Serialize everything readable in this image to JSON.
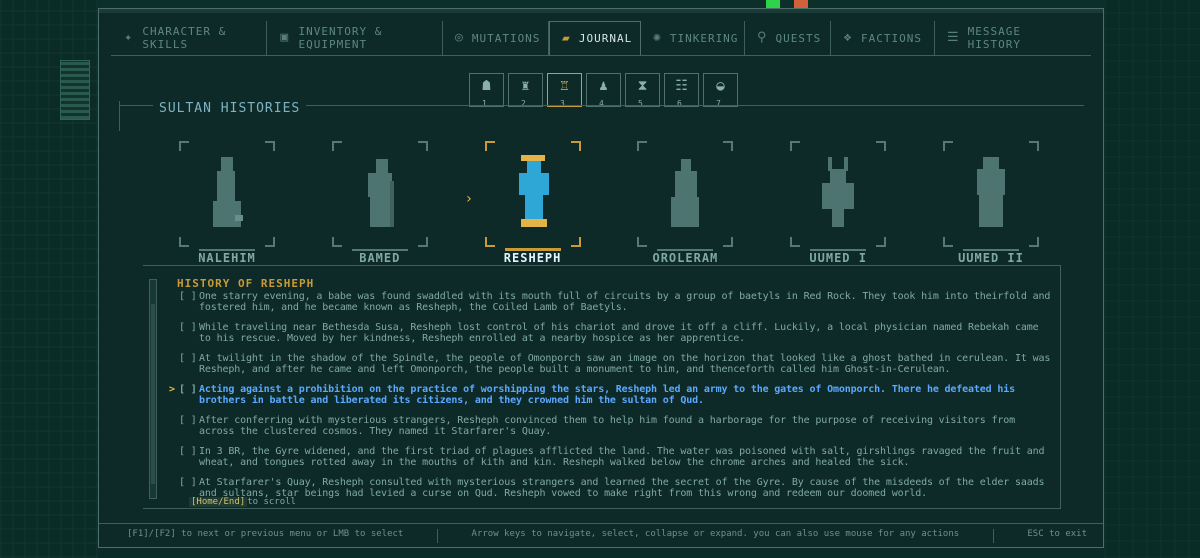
{
  "tabs": [
    {
      "label": "CHARACTER & SKILLS",
      "icon": "character-icon"
    },
    {
      "label": "INVENTORY & EQUIPMENT",
      "icon": "chest-icon"
    },
    {
      "label": "MUTATIONS",
      "icon": "mutation-icon"
    },
    {
      "label": "JOURNAL",
      "icon": "journal-icon",
      "active": true
    },
    {
      "label": "TINKERING",
      "icon": "gear-icon"
    },
    {
      "label": "QUESTS",
      "icon": "quest-icon"
    },
    {
      "label": "FACTIONS",
      "icon": "factions-icon"
    },
    {
      "label": "MESSAGE HISTORY",
      "icon": "message-icon"
    }
  ],
  "subtabs": [
    {
      "num": "1",
      "icon": "person-icon"
    },
    {
      "num": "2",
      "icon": "map-icon"
    },
    {
      "num": "3",
      "icon": "sultan-icon",
      "active": true
    },
    {
      "num": "4",
      "icon": "bell-icon"
    },
    {
      "num": "5",
      "icon": "hourglass-icon"
    },
    {
      "num": "6",
      "icon": "list-icon"
    },
    {
      "num": "7",
      "icon": "bowl-icon"
    }
  ],
  "section_title": "SULTAN HISTORIES",
  "sultans": [
    {
      "name": "NALEHIM"
    },
    {
      "name": "BAMED"
    },
    {
      "name": "RESHEPH",
      "active": true
    },
    {
      "name": "OROLERAM"
    },
    {
      "name": "UUMED I"
    },
    {
      "name": "UUMED II"
    }
  ],
  "history_title": "HISTORY OF RESHEPH",
  "entries": [
    {
      "box": "[ ]",
      "text": "One starry evening, a babe was found swaddled with its mouth full of circuits by a group of baetyls in Red Rock. They took him into theirfold and fostered him, and he became known as Resheph, the Coiled Lamb of Baetyls."
    },
    {
      "box": "[ ]",
      "text": "While traveling near Bethesda Susa, Resheph lost control of his chariot and drove it off a cliff. Luckily, a local physician named Rebekah came to his rescue. Moved by her kindness, Resheph enrolled at a nearby hospice as her apprentice."
    },
    {
      "box": "[ ]",
      "text": "At twilight in the shadow of the Spindle, the people of Omonporch saw an image on the horizon that looked like a ghost bathed in cerulean. It was Resheph, and after he came and left Omonporch, the people built a monument to him, and thenceforth called him Ghost-in-Cerulean."
    },
    {
      "box": "[ ]",
      "caret": ">",
      "active": true,
      "text": "Acting against a prohibition on the practice of worshipping the stars, Resheph led an army to the gates of Omonporch. There he defeated his brothers in battle and liberated its citizens, and they crowned him the sultan of Qud."
    },
    {
      "box": "[ ]",
      "text": "After conferring with mysterious strangers, Resheph convinced them to help him found a harborage for the purpose of receiving visitors from across the clustered cosmos. They named it Starfarer's Quay."
    },
    {
      "box": "[ ]",
      "text": "In 3 BR, the Gyre widened, and the first triad of plagues afflicted the land. The water was poisoned with salt, girshlings ravaged the fruit and wheat, and tongues rotted away in the mouths of kith and kin. Resheph walked below the chrome arches and healed the sick."
    },
    {
      "box": "[ ]",
      "text": "At Starfarer's Quay, Resheph consulted with mysterious strangers and learned the secret of the Gyre. By cause of the misdeeds of the elder  saads and sultans, star beings had levied a curse on Qud. Resheph vowed to make right from this wrong and redeem our doomed world."
    }
  ],
  "scroll_hint": {
    "key": "[Home/End]",
    "text": "to scroll"
  },
  "footer": {
    "left": "[F1]/[F2] to next or previous menu or LMB to select",
    "center": "Arrow keys to navigate, select, collapse or expand. you can also use mouse for any actions",
    "right": "ESC to exit"
  },
  "colors": {
    "accent": "#c89a38",
    "active_entry": "#5aa8ff",
    "panel": "#0e2a28",
    "border": "#4d6e6a"
  }
}
